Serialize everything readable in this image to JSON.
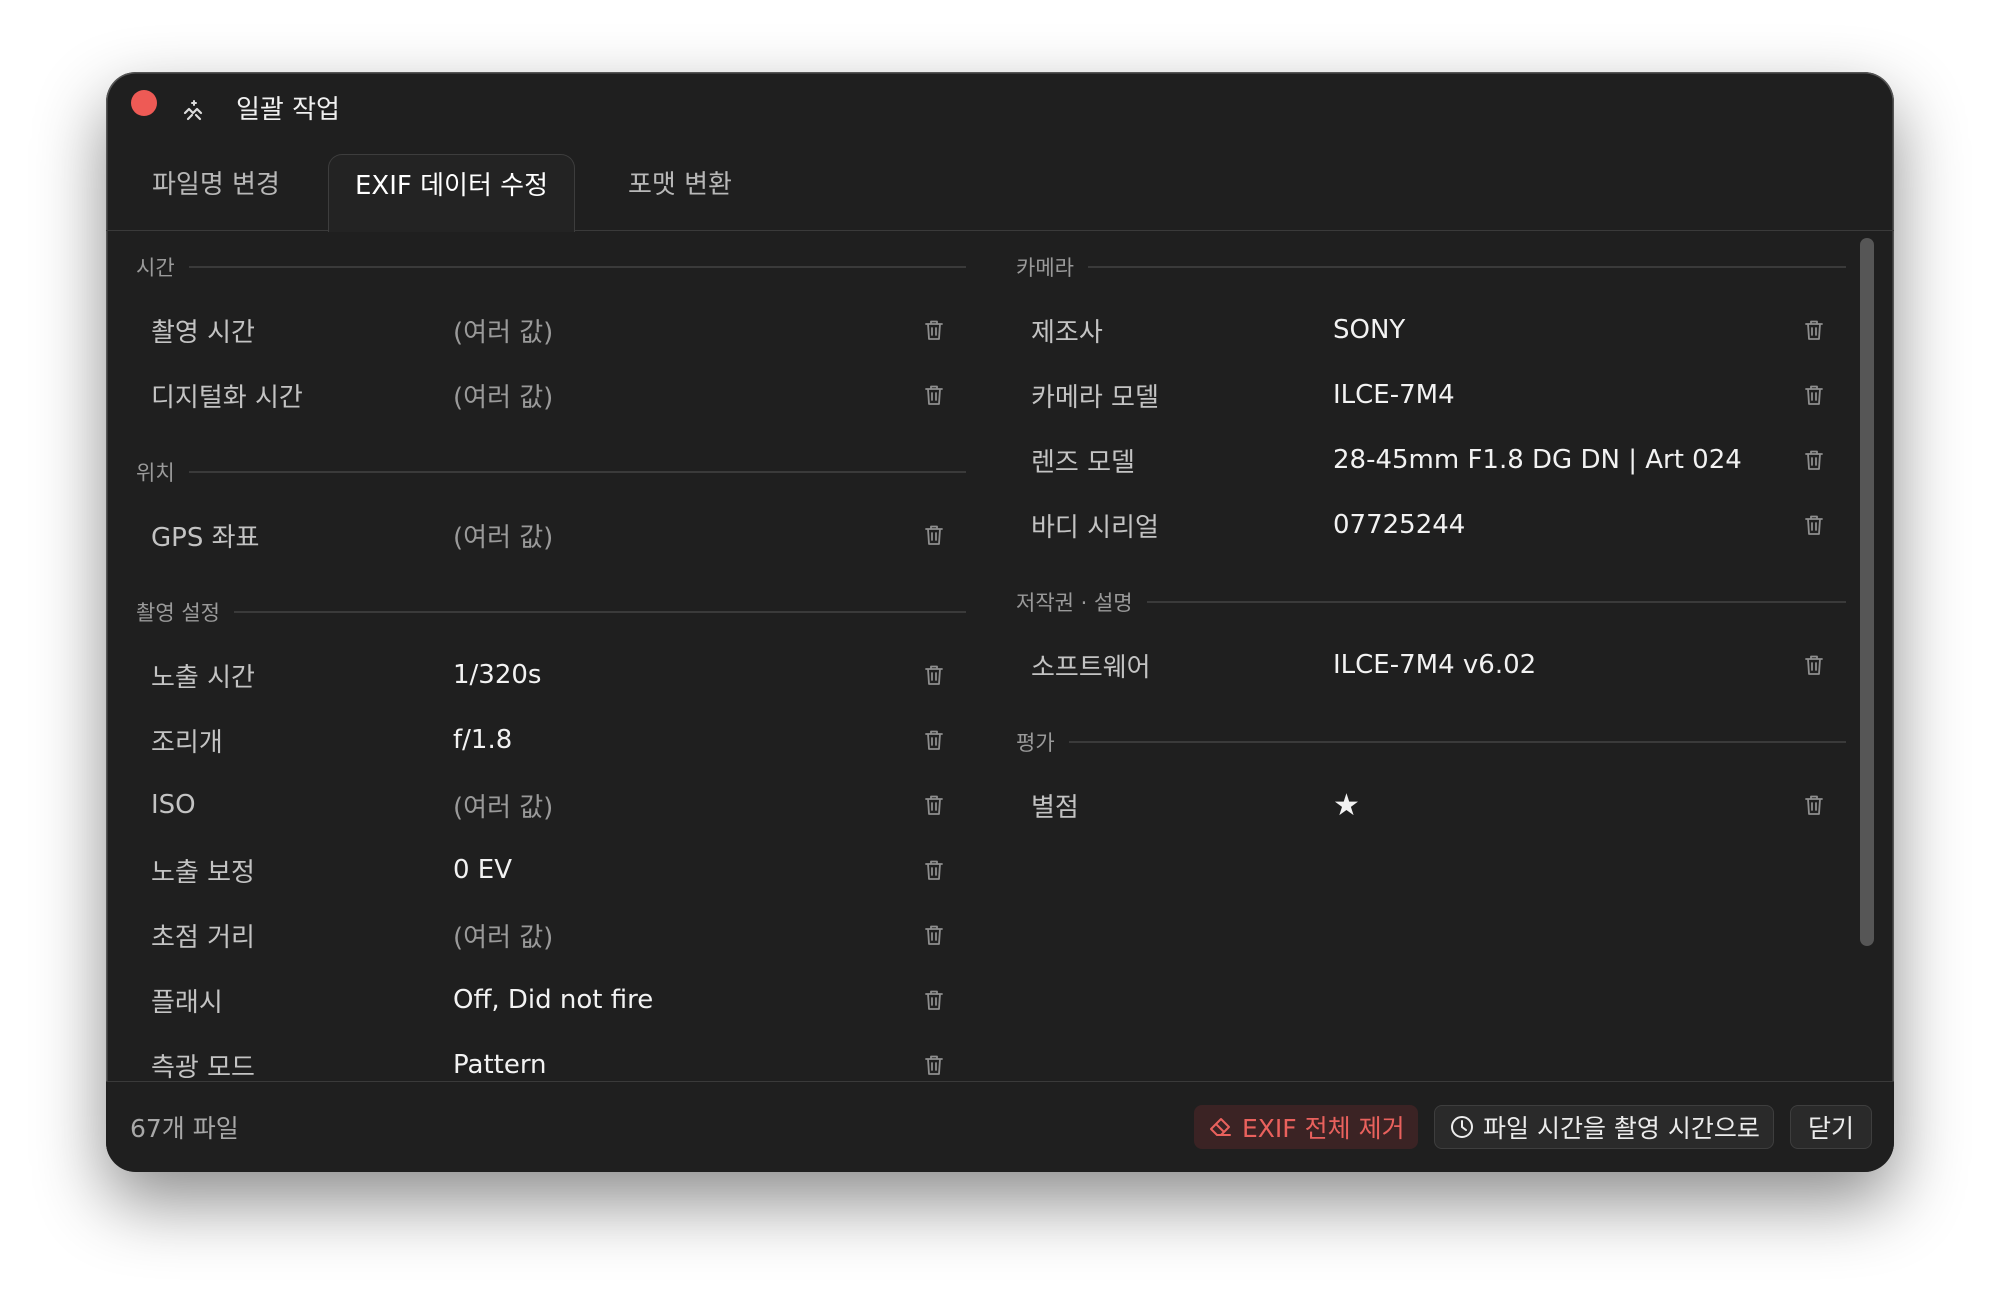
{
  "window": {
    "title": "일괄 작업",
    "close_color": "#ee5a55"
  },
  "tabs": [
    {
      "label": "파일명 변경",
      "active": false
    },
    {
      "label": "EXIF 데이터 수정",
      "active": true
    },
    {
      "label": "포맷 변환",
      "active": false
    }
  ],
  "sections": {
    "time": {
      "title": "시간",
      "rows": [
        {
          "label": "촬영 시간",
          "value": "(여러 값)"
        },
        {
          "label": "디지털화 시간",
          "value": "(여러 값)"
        }
      ]
    },
    "location": {
      "title": "위치",
      "rows": [
        {
          "label": "GPS 좌표",
          "value": "(여러 값)"
        }
      ]
    },
    "shooting": {
      "title": "촬영 설정",
      "rows": [
        {
          "label": "노출 시간",
          "value": "1/320s"
        },
        {
          "label": "조리개",
          "value": "f/1.8"
        },
        {
          "label": "ISO",
          "value": "(여러 값)"
        },
        {
          "label": "노출 보정",
          "value": "0 EV"
        },
        {
          "label": "초점 거리",
          "value": "(여러 값)"
        },
        {
          "label": "플래시",
          "value": "Off, Did not fire"
        },
        {
          "label": "측광 모드",
          "value": "Pattern"
        }
      ]
    },
    "camera": {
      "title": "카메라",
      "rows": [
        {
          "label": "제조사",
          "value": "SONY"
        },
        {
          "label": "카메라 모델",
          "value": "ILCE-7M4"
        },
        {
          "label": "렌즈 모델",
          "value": "28-45mm F1.8 DG DN | Art 024"
        },
        {
          "label": "바디 시리얼",
          "value": "07725244"
        }
      ]
    },
    "copyright": {
      "title": "저작권 · 설명",
      "rows": [
        {
          "label": "소프트웨어",
          "value": "ILCE-7M4 v6.02"
        }
      ]
    },
    "rating": {
      "title": "평가",
      "rows": [
        {
          "label": "별점",
          "value": "★"
        }
      ]
    }
  },
  "footer": {
    "file_count": "67개 파일",
    "remove_all_label": "EXIF 전체 제거",
    "sync_time_label": "파일 시간을 촬영 시간으로",
    "close_label": "닫기"
  },
  "icons": {
    "close": "close-dot",
    "title": "magic-wand-icon",
    "delete": "trash-icon",
    "remove_all": "eraser-icon",
    "sync_time": "clock-icon"
  },
  "colors": {
    "background": "#1f1f1f",
    "danger_text": "#e9615d",
    "danger_bg": "#3b2324"
  }
}
